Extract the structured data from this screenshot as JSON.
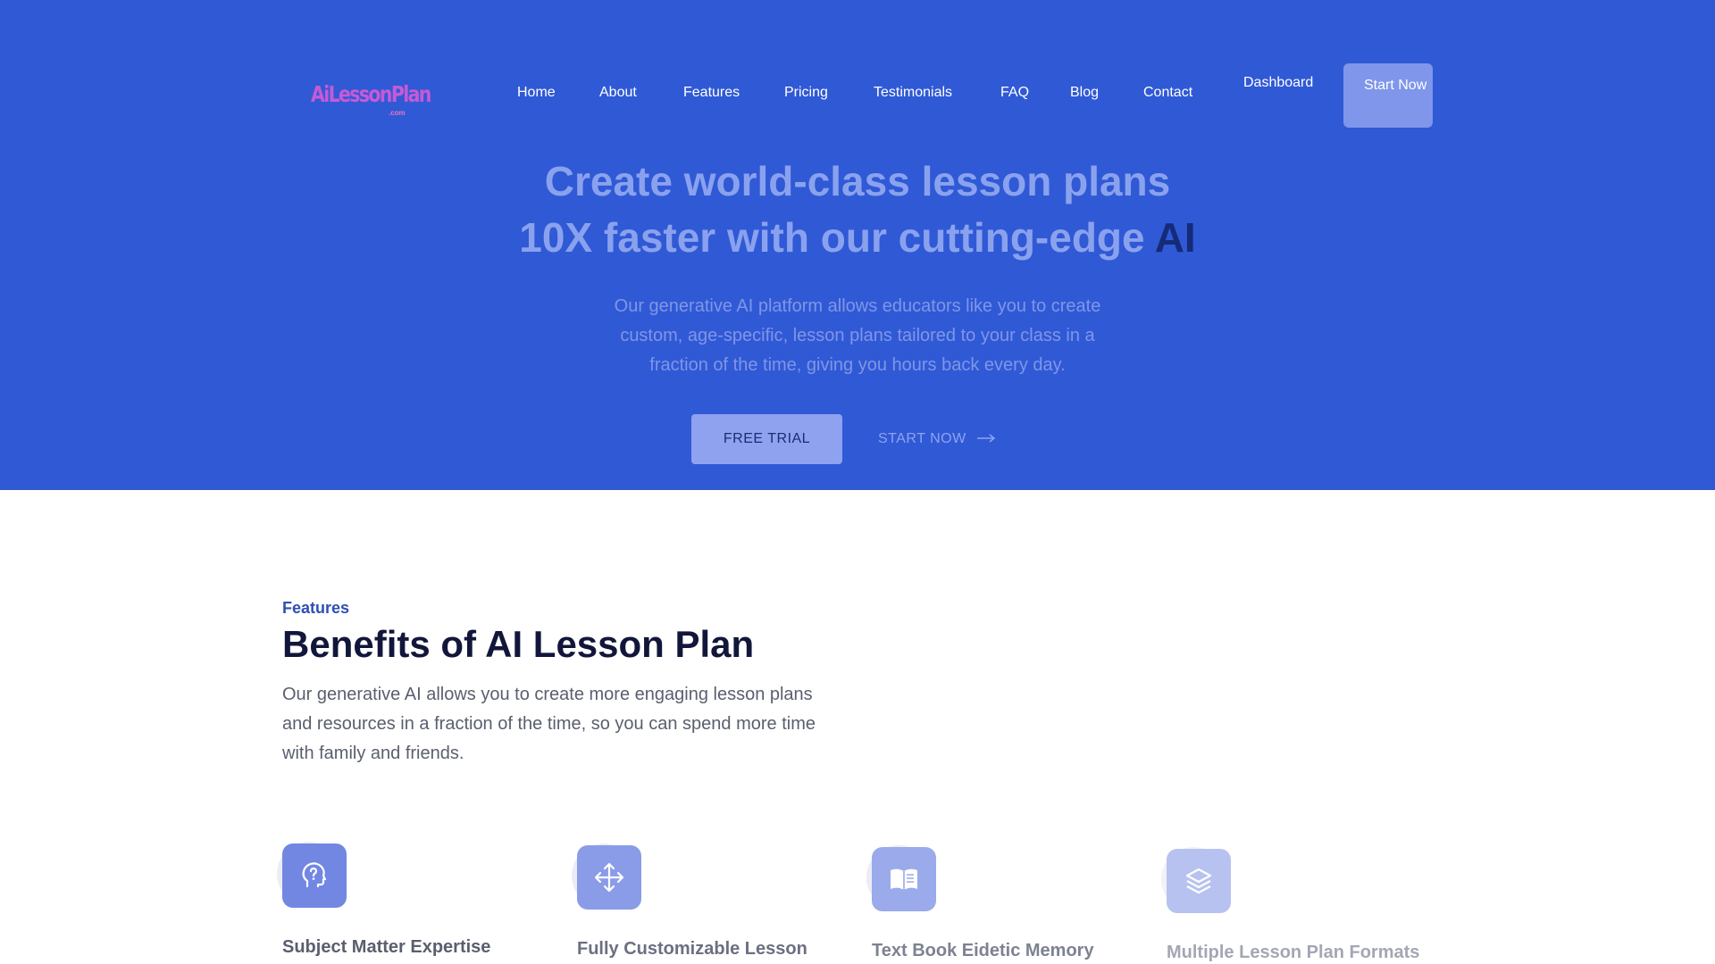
{
  "logo": {
    "text": "AiLessonPlan",
    "suffix": ".com"
  },
  "nav": {
    "items": [
      "Home",
      "About",
      "Features",
      "Pricing",
      "Testimonials",
      "FAQ",
      "Blog",
      "Contact"
    ],
    "dashboard": "Dashboard",
    "start_now": "Start Now"
  },
  "hero": {
    "title_line1": "Create world-class lesson plans",
    "title_line2_main": "10X faster with our cutting-edge ",
    "title_line2_accent": "AI",
    "subtitle": "Our generative AI platform allows educators like you to create custom, age-specific, lesson plans tailored to your class in a fraction of the time, giving you hours back every day.",
    "free_trial": "FREE TRIAL",
    "start_now": "START NOW"
  },
  "features": {
    "label": "Features",
    "title": "Benefits of AI Lesson Plan",
    "description": "Our generative AI allows you to create more engaging lesson plans and resources in a fraction of the time, so you can spend more time with family and friends.",
    "cards": [
      {
        "title": "Subject Matter Expertise",
        "icon": "head-question-icon"
      },
      {
        "title": "Fully Customizable Lesson",
        "icon": "move-arrows-icon"
      },
      {
        "title": "Text Book Eidetic Memory",
        "icon": "open-book-icon"
      },
      {
        "title": "Multiple Lesson Plan Formats",
        "icon": "layers-icon"
      }
    ]
  },
  "colors": {
    "hero_bg": "#3059d6",
    "accent_dark": "#152b78",
    "button_bg": "#8fa2ef",
    "heading_dark": "#12163a",
    "label_blue": "#2f4fb3"
  }
}
